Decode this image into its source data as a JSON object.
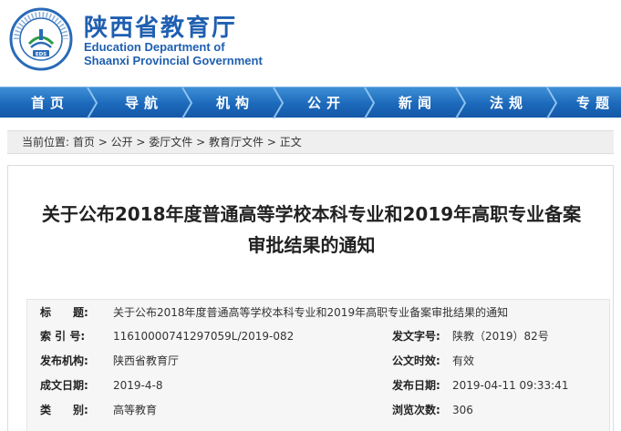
{
  "header": {
    "logo_label": "EDS",
    "seal_ring_text": "EDUCATION DEPARTMENT OF SHAANXI",
    "title_cn": "陕西省教育厅",
    "title_en_line1": "Education Department of",
    "title_en_line2": "Shaanxi Provincial Government"
  },
  "nav": {
    "items": [
      {
        "label": "首页"
      },
      {
        "label": "导航"
      },
      {
        "label": "机构"
      },
      {
        "label": "公开"
      },
      {
        "label": "新闻"
      },
      {
        "label": "法规"
      },
      {
        "label": "专题"
      }
    ]
  },
  "breadcrumb": {
    "prefix": "当前位置:",
    "items": [
      "首页",
      "公开",
      "委厅文件",
      "教育厅文件",
      "正文"
    ],
    "separator": " > "
  },
  "article": {
    "title_line1": "关于公布2018年度普通高等学校本科专业和2019年高职专业备案",
    "title_line2": "审批结果的通知"
  },
  "meta": {
    "title_label": "标　　题:",
    "title_value": "关于公布2018年度普通高等学校本科专业和2019年高职专业备案审批结果的通知",
    "index_label": "索 引 号:",
    "index_value": "11610000741297059L/2019-082",
    "doc_no_label": "发文字号:",
    "doc_no_value": "陕教（2019）82号",
    "issuer_label": "发布机构:",
    "issuer_value": "陕西省教育厅",
    "validity_label": "公文时效:",
    "validity_value": "有效",
    "created_label": "成文日期:",
    "created_value": "2019-4-8",
    "published_label": "发布日期:",
    "published_value": "2019-04-11 09:33:41",
    "category_label": "类　　别:",
    "category_value": "高等教育",
    "views_label": "浏览次数:",
    "views_value": "306"
  },
  "colors": {
    "brand_blue": "#1f5fb0",
    "nav_blue": "#1c69bb",
    "crumb_bg": "#efefef",
    "meta_bg": "#f6f6f6"
  }
}
